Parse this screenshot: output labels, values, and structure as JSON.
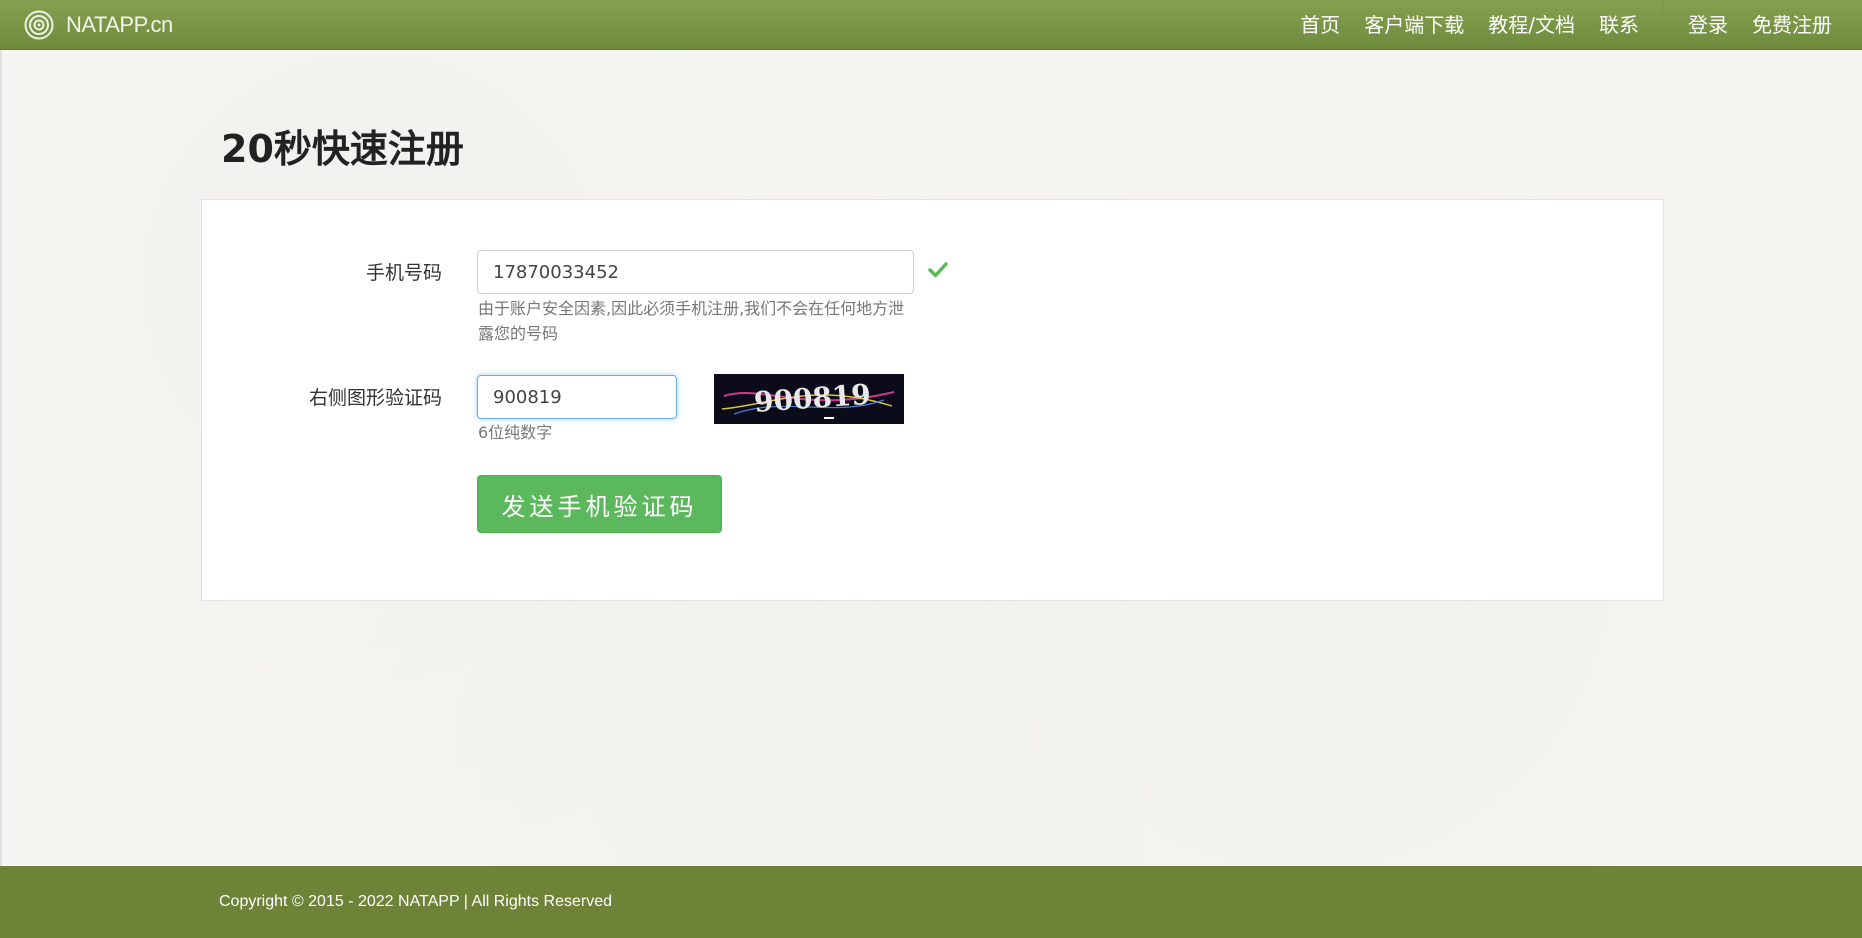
{
  "navbar": {
    "brand": "NATAPP.cn",
    "links": [
      "首页",
      "客户端下载",
      "教程/文档",
      "联系"
    ],
    "auth": [
      "登录",
      "免费注册"
    ]
  },
  "page": {
    "title": "20秒快速注册"
  },
  "form": {
    "phone": {
      "label": "手机号码",
      "value": "17870033452",
      "help": "由于账户安全因素,因此必须手机注册,我们不会在任何地方泄露您的号码"
    },
    "captcha": {
      "label": "右侧图形验证码",
      "value": "900819",
      "help": "6位纯数字",
      "image_text": "900819"
    },
    "submit_label": "发送手机验证码"
  },
  "footer": {
    "copyright": "Copyright © 2015 - 2022 NATAPP | All Rights Reserved"
  },
  "colors": {
    "navbar": "#6e8b3d",
    "footer": "#6e8338",
    "button": "#5cb85c",
    "check": "#5cb85c"
  }
}
